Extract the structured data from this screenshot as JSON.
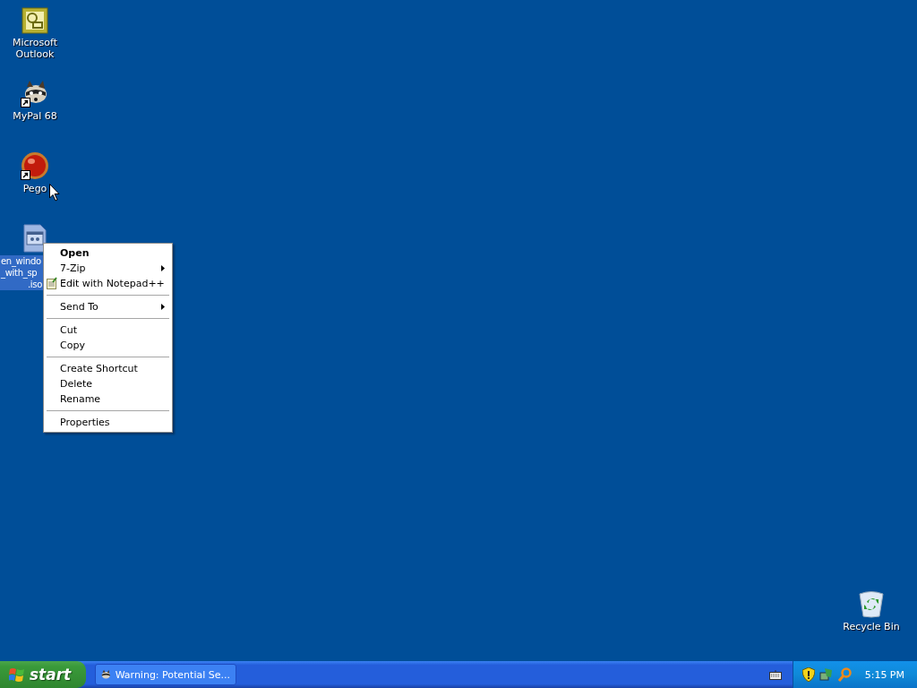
{
  "desktop_icons": [
    {
      "kind": "outlook",
      "lines": [
        "Microsoft",
        "Outlook"
      ],
      "shortcut": false,
      "selected": false
    },
    {
      "kind": "mypal",
      "lines": [
        "MyPal 68"
      ],
      "shortcut": true,
      "selected": false
    },
    {
      "kind": "pego",
      "lines": [
        "Pego"
      ],
      "shortcut": true,
      "selected": false
    },
    {
      "kind": "iso",
      "lines": [
        "en_windo",
        "_with_sp",
        ".iso"
      ],
      "shortcut": false,
      "selected": true
    },
    {
      "kind": "recycle",
      "lines": [
        "Recycle Bin"
      ],
      "shortcut": false,
      "selected": false
    }
  ],
  "context_menu": [
    {
      "kind": "item",
      "label": "Open",
      "default": true,
      "submenu": false
    },
    {
      "kind": "item",
      "label": "7-Zip",
      "default": false,
      "submenu": true
    },
    {
      "kind": "notepad_item",
      "label": "Edit with Notepad++",
      "default": false,
      "submenu": false
    },
    {
      "kind": "separator"
    },
    {
      "kind": "item",
      "label": "Send To",
      "default": false,
      "submenu": true
    },
    {
      "kind": "separator"
    },
    {
      "kind": "item",
      "label": "Cut",
      "default": false,
      "submenu": false
    },
    {
      "kind": "item",
      "label": "Copy",
      "default": false,
      "submenu": false
    },
    {
      "kind": "separator"
    },
    {
      "kind": "item",
      "label": "Create Shortcut",
      "default": false,
      "submenu": false
    },
    {
      "kind": "item",
      "label": "Delete",
      "default": false,
      "submenu": false
    },
    {
      "kind": "item",
      "label": "Rename",
      "default": false,
      "submenu": false
    },
    {
      "kind": "separator"
    },
    {
      "kind": "item",
      "label": "Properties",
      "default": false,
      "submenu": false
    }
  ],
  "taskbar": {
    "start": "start",
    "tasks": [
      {
        "label": "Warning: Potential Se...",
        "selected": false
      }
    ],
    "clock": "5:15 PM"
  }
}
